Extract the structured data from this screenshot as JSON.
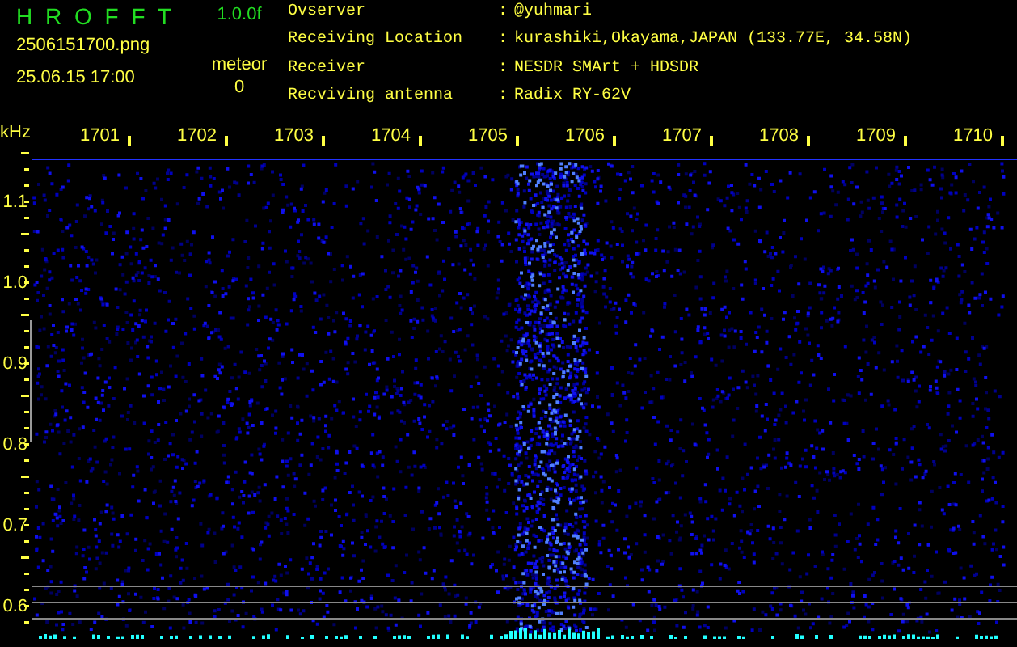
{
  "header": {
    "logo": "H R O F F T",
    "version": "1.0.0f",
    "filename": "2506151700.png",
    "timestamp": "25.06.15 17:00",
    "counter_label": "meteor",
    "counter_value": "0"
  },
  "info": [
    {
      "label": "Ovserver",
      "separator": ":",
      "value": "@yuhmari"
    },
    {
      "label": "Receiving Location",
      "separator": ":",
      "value": "kurashiki,Okayama,JAPAN (133.77E, 34.58N)"
    },
    {
      "label": "Receiver",
      "separator": ":",
      "value": "NESDR SMArt + HDSDR"
    },
    {
      "label": "Recviving antenna",
      "separator": ":",
      "value": "Radix RY-62V"
    }
  ],
  "frequency_axis": {
    "unit": "kHz",
    "labels": [
      "1701",
      "1702",
      "1703",
      "1704",
      "1705",
      "1706",
      "1707",
      "1708",
      "1709",
      "1710"
    ]
  },
  "amplitude_axis": {
    "labels": [
      "1.1",
      "1.0",
      "0.9",
      "0.8",
      "0.7",
      "0.6"
    ]
  }
}
